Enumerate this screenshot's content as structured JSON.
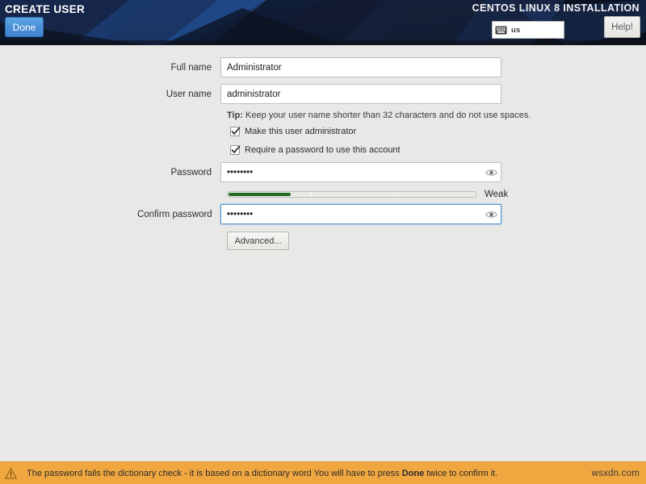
{
  "header": {
    "spoke_title": "CREATE USER",
    "installation_title": "CENTOS LINUX 8 INSTALLATION",
    "done_label": "Done",
    "help_label": "Help!",
    "keyboard_layout": "us",
    "keyboard_icon": "keyboard-icon"
  },
  "form": {
    "full_name": {
      "label": "Full name",
      "value": "Administrator",
      "placeholder": ""
    },
    "user_name": {
      "label": "User name",
      "value": "administrator",
      "placeholder": ""
    },
    "tip_prefix": "Tip:",
    "tip_text": " Keep your user name shorter than 32 characters and do not use spaces.",
    "checkbox_admin": {
      "label": "Make this user administrator",
      "checked": true
    },
    "checkbox_require_password": {
      "label": "Require a password to use this account",
      "checked": true
    },
    "password": {
      "label": "Password",
      "value": "••••••••",
      "reveal_icon": "eye-icon"
    },
    "confirm_password": {
      "label": "Confirm password",
      "value": "••••••••",
      "reveal_icon": "eye-icon",
      "focused": true
    },
    "strength": {
      "text": "Weak",
      "percent": 25,
      "fill_color": "#1f6b1f"
    },
    "advanced_label": "Advanced..."
  },
  "footer": {
    "icon": "warning-triangle-icon",
    "message_part1": "The password fails the dictionary check - it is based on a dictionary word You will have to press ",
    "message_bold": "Done",
    "message_part2": " twice to confirm it.",
    "watermark": "wsxdn.com",
    "background_color": "#f0a740"
  }
}
